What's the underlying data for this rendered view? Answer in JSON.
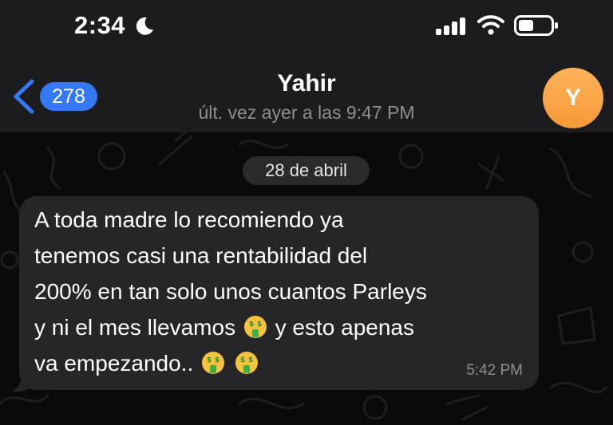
{
  "status": {
    "time": "2:34"
  },
  "nav": {
    "back_count": "278",
    "contact_name": "Yahir",
    "last_seen": "últ. vez ayer a las 9:47 PM",
    "avatar_initial": "Y"
  },
  "chat": {
    "date_label": "28 de abril",
    "message": {
      "lines": [
        "A toda madre lo recomiendo ya",
        "tenemos casi una rentabilidad del",
        "200% en tan solo unos cuantos Parleys",
        "y ni el mes llevamos",
        "y esto apenas",
        "va empezando.."
      ],
      "emoji": "money-mouth-face",
      "time": "5:42 PM"
    }
  },
  "colors": {
    "accent": "#3478f6",
    "avatar": "#f7a445",
    "bubble": "#262628",
    "background": "#0a0a0a"
  }
}
